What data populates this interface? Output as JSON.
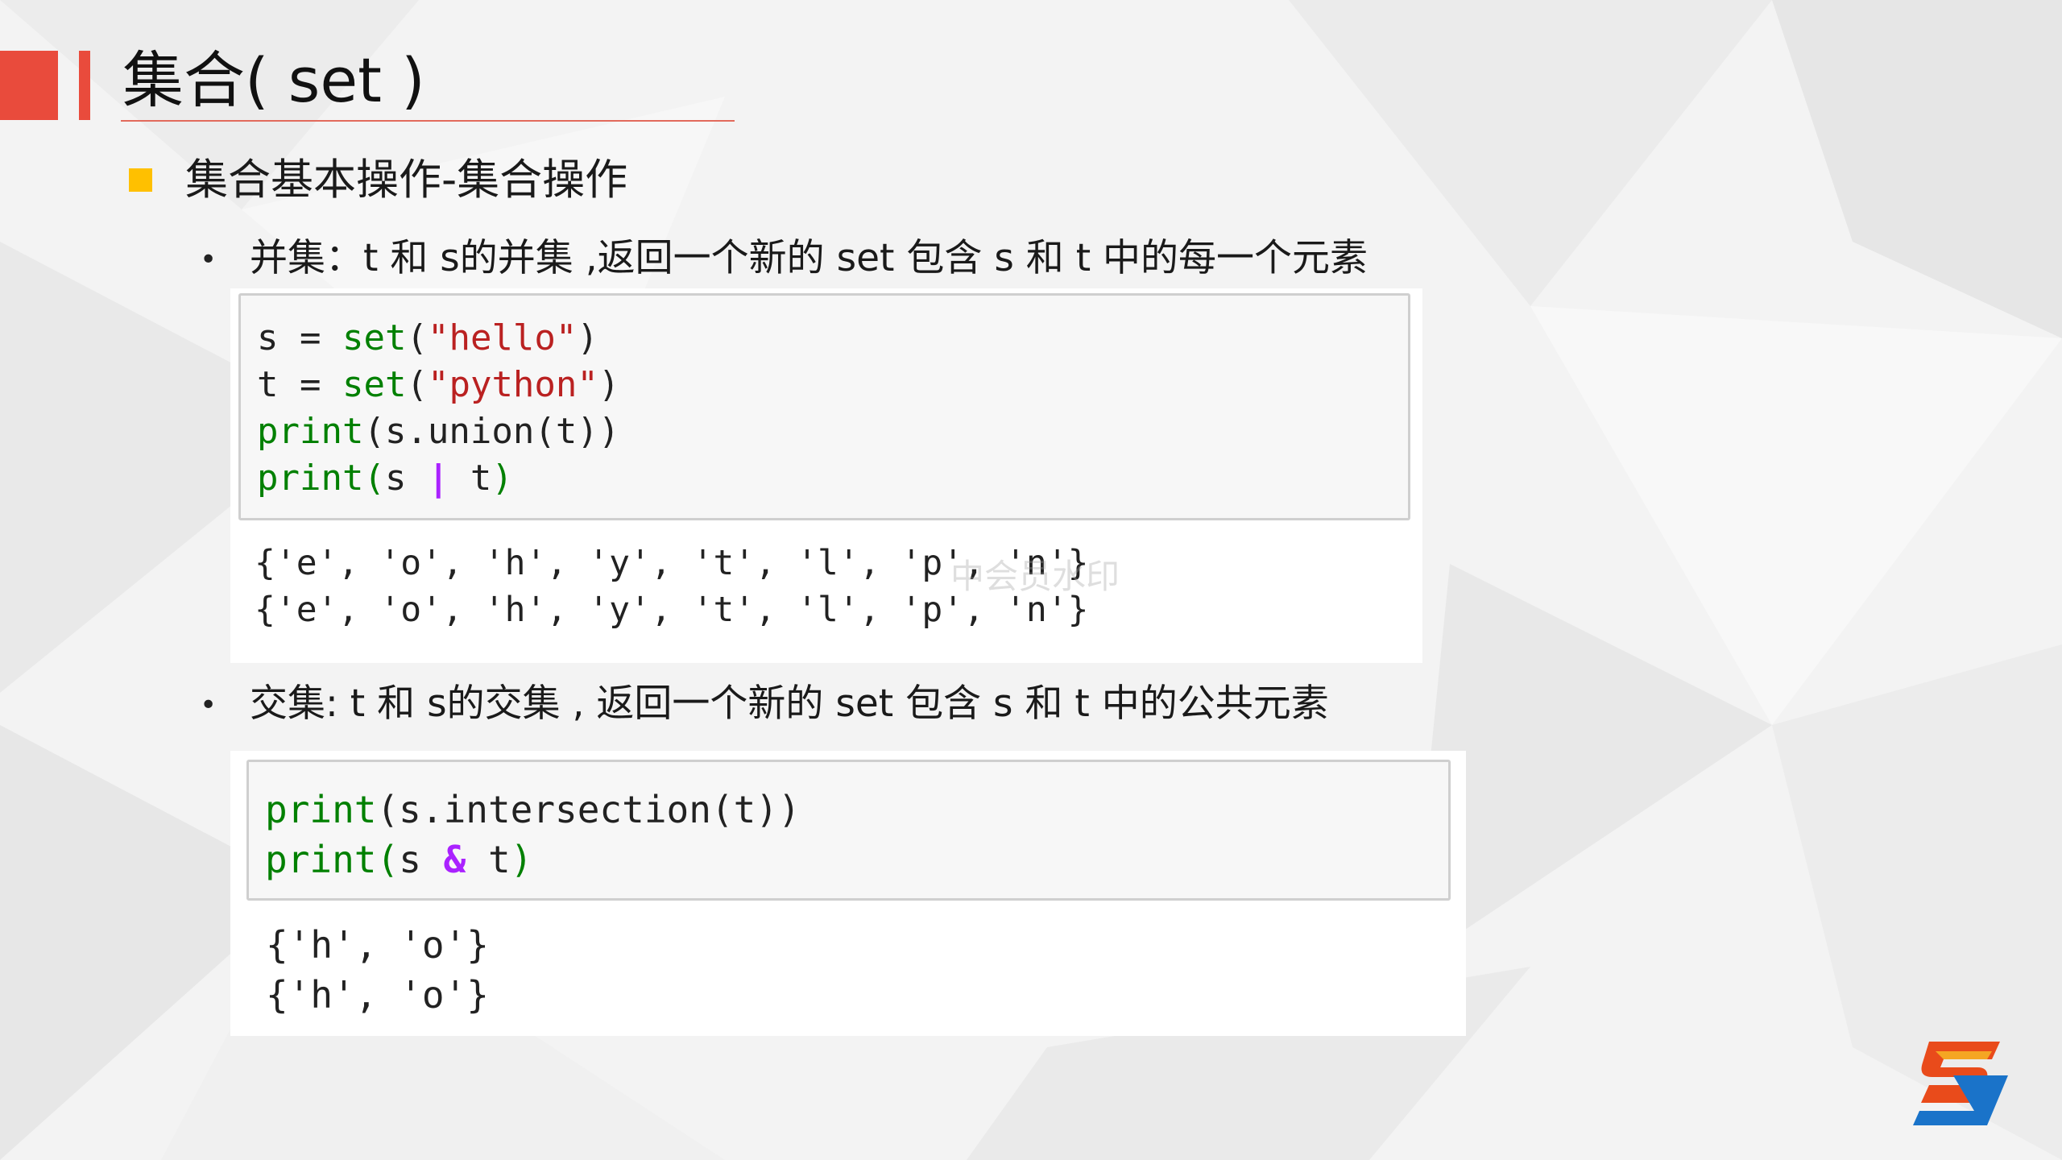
{
  "slide": {
    "title": "集合( set )",
    "section_heading": "集合基本操作-集合操作",
    "watermark": "中会员水印",
    "colors": {
      "accent_red": "#e94b3c",
      "bullet_yellow": "#ffc000",
      "code_green": "#008000",
      "string_red": "#ba2121",
      "operator_purple": "#aa22ff"
    },
    "icons": {
      "bullet": "square-bullet",
      "logo": "s-logo-icon"
    }
  },
  "union": {
    "bullet": "•",
    "text": "并集：t 和 s的并集 ,返回一个新的 set 包含 s 和 t 中的每一个元素",
    "code": {
      "line1": {
        "var": "s",
        "op": " = ",
        "func": "set",
        "open": "(",
        "str": "\"hello\"",
        "close": ")"
      },
      "line2": {
        "var": "t",
        "op": " = ",
        "func": "set",
        "open": "(",
        "str": "\"python\"",
        "close": ")"
      },
      "line3": {
        "func": "print",
        "rest": "(s.union(t))"
      },
      "line4": {
        "func": "print",
        "open": "(",
        "left": "s ",
        "op": "|",
        "right": " t",
        "close": ")"
      }
    },
    "output": [
      "{'e', 'o', 'h', 'y', 't', 'l', 'p', 'n'}",
      "{'e', 'o', 'h', 'y', 't', 'l', 'p', 'n'}"
    ]
  },
  "intersection": {
    "bullet": "•",
    "text": "交集: t 和 s的交集 , 返回一个新的 set 包含 s 和 t 中的公共元素",
    "code": {
      "line1": {
        "func": "print",
        "rest": "(s.intersection(t))"
      },
      "line2": {
        "func": "print",
        "open": "(",
        "left": "s ",
        "op": "&",
        "right": " t",
        "close": ")"
      }
    },
    "output": [
      "{'h', 'o'}",
      "{'h', 'o'}"
    ]
  }
}
